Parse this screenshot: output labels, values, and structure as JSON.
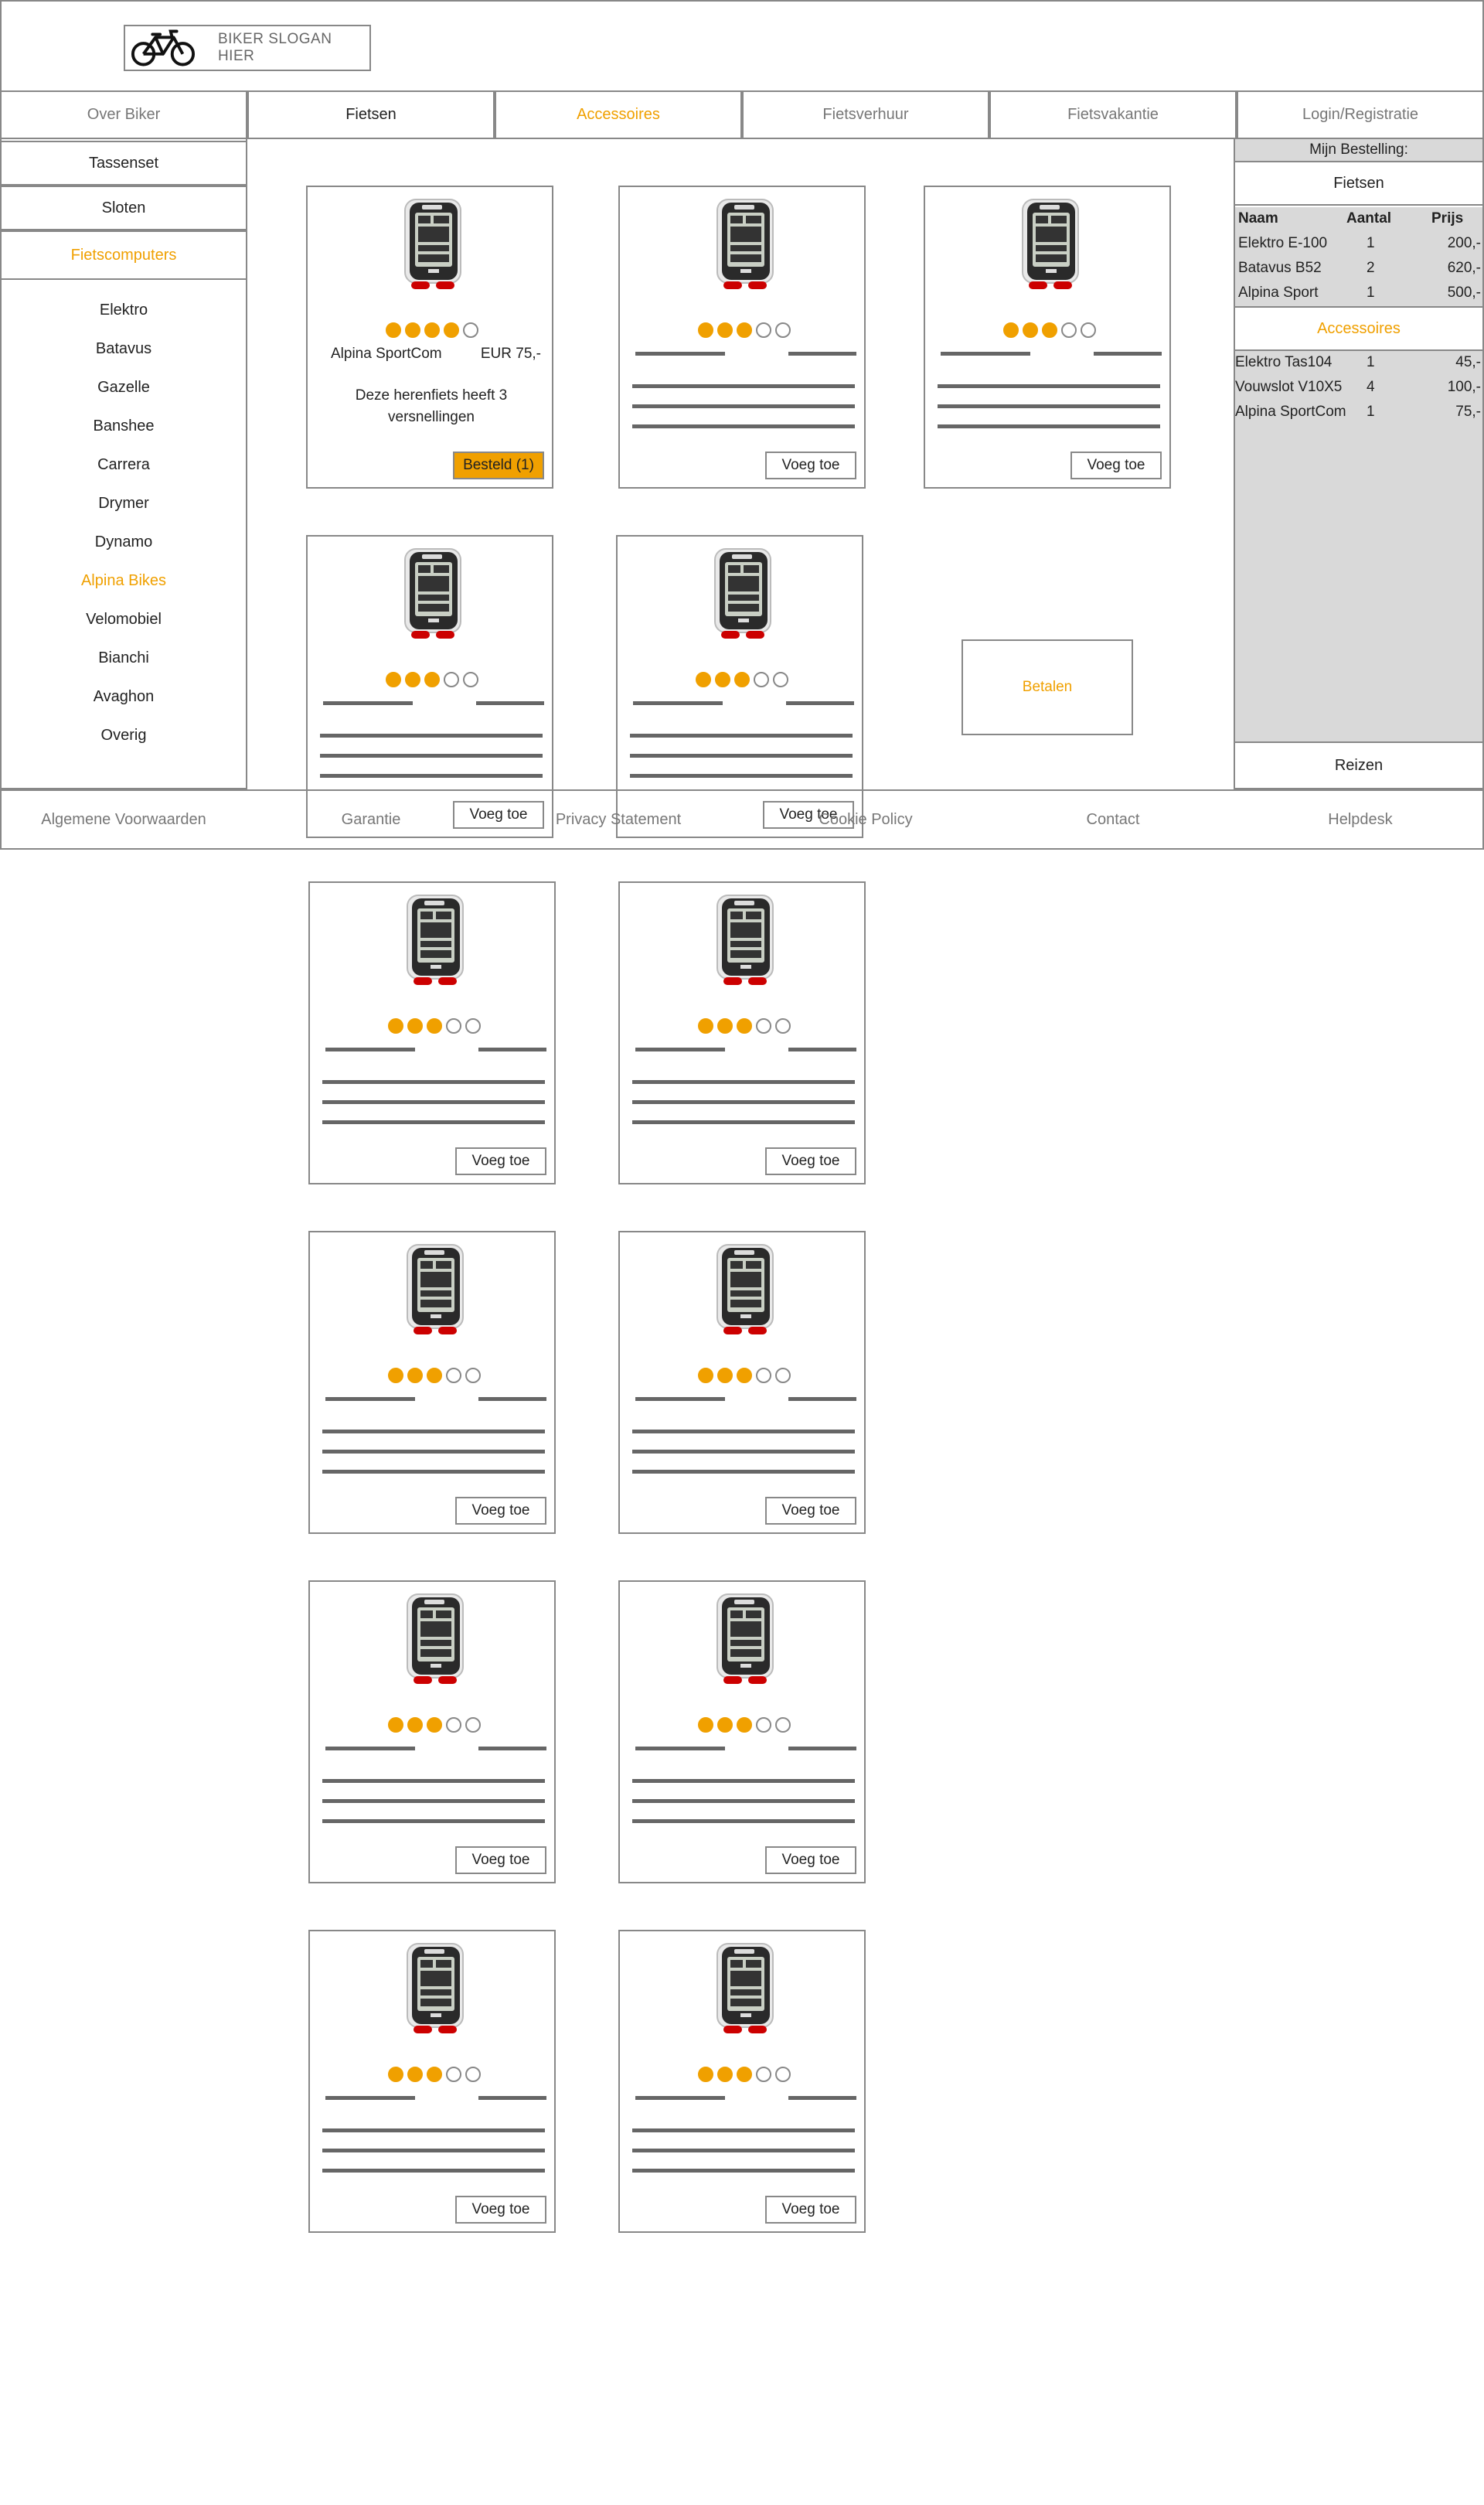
{
  "header": {
    "slogan": "BIKER SLOGAN HIER",
    "logo_icon": "bicycle-icon"
  },
  "nav": [
    {
      "label": "Over Biker",
      "state": "normal"
    },
    {
      "label": "Fietsen",
      "state": "dark"
    },
    {
      "label": "Accessoires",
      "state": "active"
    },
    {
      "label": "Fietsverhuur",
      "state": "normal"
    },
    {
      "label": "Fietsvakantie",
      "state": "normal"
    },
    {
      "label": "Login/Registratie",
      "state": "normal"
    }
  ],
  "sidebar": {
    "categories": [
      {
        "label": "Tassenset",
        "active": false
      },
      {
        "label": "Sloten",
        "active": false
      },
      {
        "label": "Fietscomputers",
        "active": true
      }
    ],
    "brands": [
      {
        "label": "Elektro",
        "active": false
      },
      {
        "label": "Batavus",
        "active": false
      },
      {
        "label": "Gazelle",
        "active": false
      },
      {
        "label": "Banshee",
        "active": false
      },
      {
        "label": "Carrera",
        "active": false
      },
      {
        "label": "Drymer",
        "active": false
      },
      {
        "label": "Dynamo",
        "active": false
      },
      {
        "label": "Alpina Bikes",
        "active": true
      },
      {
        "label": "Velomobiel",
        "active": false
      },
      {
        "label": "Bianchi",
        "active": false
      },
      {
        "label": "Avaghon",
        "active": false
      },
      {
        "label": "Overig",
        "active": false
      }
    ]
  },
  "featured_product": {
    "name": "Alpina SportCom",
    "price": "EUR 75,-",
    "description": "Deze herenfiets heeft 3 versnellingen",
    "rating": 4,
    "ordered_label": "Besteld (1)"
  },
  "product_card": {
    "add_label": "Voeg toe",
    "rating": 3,
    "max_rating": 5
  },
  "pay_label": "Betalen",
  "order": {
    "title": "Mijn Bestelling:",
    "bikes_label": "Fietsen",
    "columns": [
      "Naam",
      "Aantal",
      "Prijs"
    ],
    "bikes": [
      {
        "name": "Elektro E-100",
        "qty": "1",
        "price": "200,-"
      },
      {
        "name": "Batavus B52",
        "qty": "2",
        "price": "620,-"
      },
      {
        "name": "Alpina Sport",
        "qty": "1",
        "price": "500,-"
      }
    ],
    "accessories_label": "Accessoires",
    "accessories": [
      {
        "name": "Elektro Tas104",
        "qty": "1",
        "price": "45,-"
      },
      {
        "name": "Vouwslot V10X5",
        "qty": "4",
        "price": "100,-"
      },
      {
        "name": "Alpina SportCom",
        "qty": "1",
        "price": "75,-"
      }
    ],
    "travel_label": "Reizen"
  },
  "footer": [
    "Algemene Voorwaarden",
    "Garantie",
    "Privacy Statement",
    "Cookie Policy",
    "Contact",
    "Helpdesk"
  ],
  "colors": {
    "accent": "#f0a000",
    "border": "#888888",
    "panel": "#d9d9d9"
  }
}
